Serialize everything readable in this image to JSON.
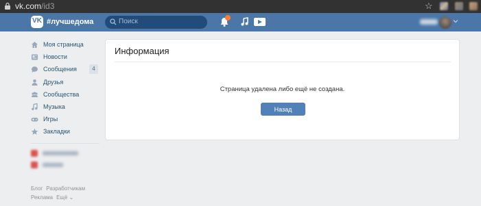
{
  "browser": {
    "url_host": "vk.com",
    "url_path": "/id3"
  },
  "header": {
    "logo_text": "VK",
    "brand": "#лучшедома",
    "search_placeholder": "Поиск"
  },
  "sidebar": {
    "items": [
      {
        "label": "Моя страница",
        "icon": "home-icon"
      },
      {
        "label": "Новости",
        "icon": "news-icon"
      },
      {
        "label": "Сообщения",
        "icon": "messages-icon",
        "count": "4"
      },
      {
        "label": "Друзья",
        "icon": "friends-icon"
      },
      {
        "label": "Сообщества",
        "icon": "groups-icon"
      },
      {
        "label": "Музыка",
        "icon": "music-icon"
      },
      {
        "label": "Игры",
        "icon": "games-icon"
      },
      {
        "label": "Закладки",
        "icon": "star-icon"
      }
    ]
  },
  "footer": {
    "links_row1": [
      "Блог",
      "Разработчикам"
    ],
    "links_row2": [
      "Реклама",
      "Ещё ⌄"
    ]
  },
  "card": {
    "title": "Информация",
    "message": "Страница удалена либо ещё не создана.",
    "button": "Назад"
  },
  "colors": {
    "header": "#4a76a8",
    "button": "#5181b8",
    "link": "#285473",
    "notification_badge": "#ff7b2e"
  }
}
